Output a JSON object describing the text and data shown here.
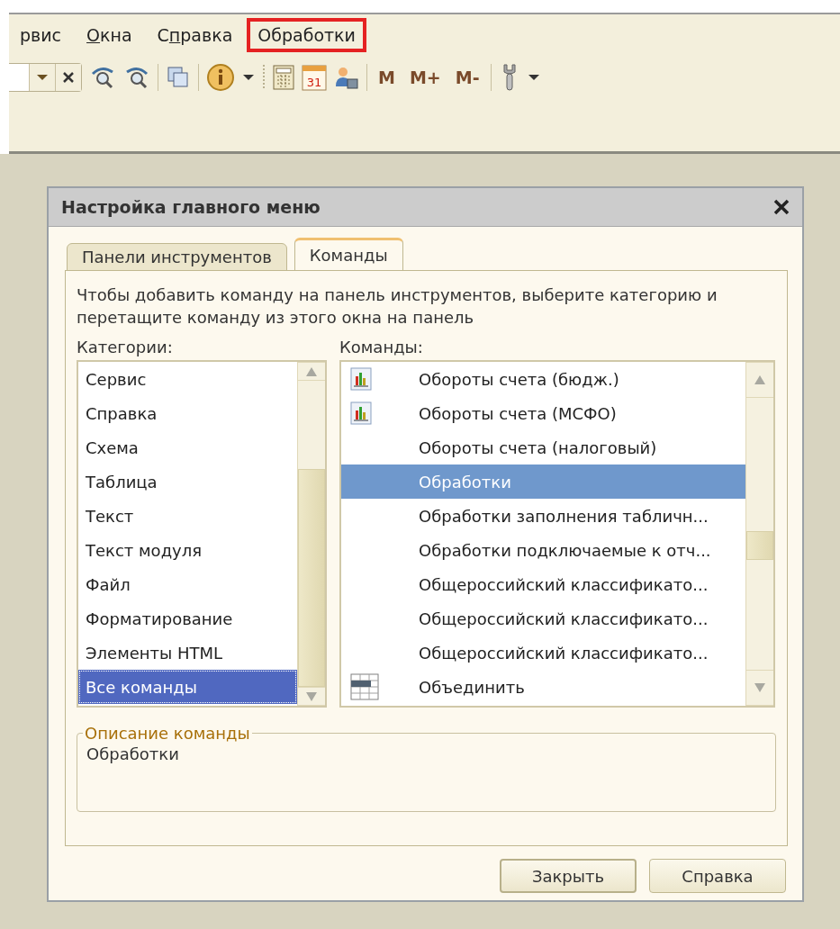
{
  "menu_bar": {
    "items": [
      {
        "before": "рвис",
        "highlighted": false
      },
      {
        "accel": "О",
        "after": "кна",
        "highlighted": false
      },
      {
        "before": "С",
        "accel": "п",
        "after": "равка",
        "highlighted": false
      },
      {
        "before": "Обработки",
        "highlighted": true
      }
    ]
  },
  "toolbar": {
    "calendar_day": "31",
    "memory_buttons": [
      "M",
      "M+",
      "M-"
    ]
  },
  "dialog": {
    "title": "Настройка главного меню",
    "tabs": [
      {
        "label": "Панели инструментов",
        "selected": false
      },
      {
        "label": "Команды",
        "selected": true
      }
    ],
    "hint": "Чтобы добавить команду на панель инструментов, выберите категорию и перетащите команду из этого окна на панель",
    "categories": {
      "label": "Категории:",
      "items": [
        {
          "label": "Сервис",
          "selected": false
        },
        {
          "label": "Справка",
          "selected": false
        },
        {
          "label": "Схема",
          "selected": false
        },
        {
          "label": "Таблица",
          "selected": false
        },
        {
          "label": "Текст",
          "selected": false
        },
        {
          "label": "Текст модуля",
          "selected": false
        },
        {
          "label": "Файл",
          "selected": false
        },
        {
          "label": "Форматирование",
          "selected": false
        },
        {
          "label": "Элементы HTML",
          "selected": false
        },
        {
          "label": "Все команды",
          "selected": true
        }
      ]
    },
    "commands": {
      "label": "Команды:",
      "items": [
        {
          "label": "Обороты счета (бюдж.)",
          "kind": "report",
          "selected": false
        },
        {
          "label": "Обороты счета (МСФО)",
          "kind": "report",
          "selected": false
        },
        {
          "label": "Обороты счета (налоговый)",
          "kind": "plain",
          "selected": false
        },
        {
          "label": "Обработки",
          "kind": "plain",
          "selected": true
        },
        {
          "label": "Обработки заполнения табличн...",
          "kind": "plain",
          "selected": false
        },
        {
          "label": "Обработки подключаемые к отч...",
          "kind": "plain",
          "selected": false
        },
        {
          "label": "Общероссийский классификато...",
          "kind": "plain",
          "selected": false
        },
        {
          "label": "Общероссийский классификато...",
          "kind": "plain",
          "selected": false
        },
        {
          "label": "Общероссийский классификато...",
          "kind": "plain",
          "selected": false
        },
        {
          "label": "Объединить",
          "kind": "merge",
          "selected": false
        }
      ]
    },
    "description": {
      "legend": "Описание команды",
      "text": "Обработки"
    },
    "buttons": [
      "Закрыть",
      "Справка"
    ]
  }
}
